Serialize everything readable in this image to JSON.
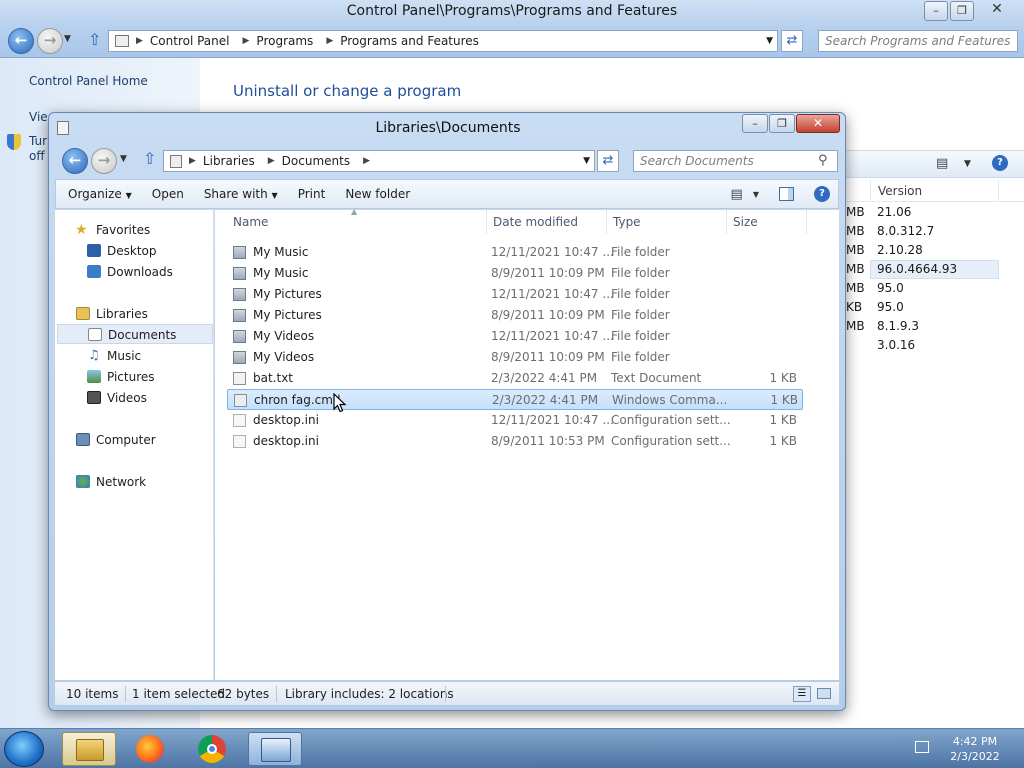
{
  "control_panel": {
    "title": "Control Panel\\Programs\\Programs and Features",
    "breadcrumbs": [
      "Control Panel",
      "Programs",
      "Programs and Features"
    ],
    "search_placeholder": "Search Programs and Features",
    "sidebar": {
      "home": "Control Panel Home",
      "view_partial": "Vie",
      "turn_partial_1": "Tur",
      "turn_partial_2": "off"
    },
    "heading": "Uninstall or change a program",
    "version_header": "Version",
    "size_suffixes": [
      "MB",
      "MB",
      "MB",
      "MB",
      "MB",
      "KB",
      "MB"
    ],
    "versions": [
      "21.06",
      "8.0.312.7",
      "2.10.28",
      "96.0.4664.93",
      "95.0",
      "95.0",
      "8.1.9.3",
      "3.0.16"
    ]
  },
  "explorer": {
    "title": "Libraries\\Documents",
    "breadcrumbs": [
      "Libraries",
      "Documents"
    ],
    "search_placeholder": "Search Documents",
    "toolbar": {
      "organize": "Organize",
      "open": "Open",
      "share_with": "Share with",
      "print": "Print",
      "new_folder": "New folder"
    },
    "nav": {
      "favorites": "Favorites",
      "desktop": "Desktop",
      "downloads": "Downloads",
      "libraries": "Libraries",
      "documents": "Documents",
      "music": "Music",
      "pictures": "Pictures",
      "videos": "Videos",
      "computer": "Computer",
      "network": "Network"
    },
    "columns": [
      "Name",
      "Date modified",
      "Type",
      "Size"
    ],
    "files": [
      {
        "name": "My Music",
        "date": "12/11/2021 10:47 ...",
        "type": "File folder",
        "size": "",
        "icon": "folder-shortcut-icon"
      },
      {
        "name": "My Music",
        "date": "8/9/2011 10:09 PM",
        "type": "File folder",
        "size": "",
        "icon": "folder-shortcut-icon"
      },
      {
        "name": "My Pictures",
        "date": "12/11/2021 10:47 ...",
        "type": "File folder",
        "size": "",
        "icon": "folder-shortcut-icon"
      },
      {
        "name": "My Pictures",
        "date": "8/9/2011 10:09 PM",
        "type": "File folder",
        "size": "",
        "icon": "folder-shortcut-icon"
      },
      {
        "name": "My Videos",
        "date": "12/11/2021 10:47 ...",
        "type": "File folder",
        "size": "",
        "icon": "folder-shortcut-icon"
      },
      {
        "name": "My Videos",
        "date": "8/9/2011 10:09 PM",
        "type": "File folder",
        "size": "",
        "icon": "folder-shortcut-icon"
      },
      {
        "name": "bat.txt",
        "date": "2/3/2022 4:41 PM",
        "type": "Text Document",
        "size": "1 KB",
        "icon": "text-file-icon"
      },
      {
        "name": "chron fag.cmd",
        "date": "2/3/2022 4:41 PM",
        "type": "Windows Comma...",
        "size": "1 KB",
        "icon": "cmd-file-icon",
        "selected": true
      },
      {
        "name": "desktop.ini",
        "date": "12/11/2021 10:47 ...",
        "type": "Configuration sett...",
        "size": "1 KB",
        "icon": "ini-file-icon"
      },
      {
        "name": "desktop.ini",
        "date": "8/9/2011 10:53 PM",
        "type": "Configuration sett...",
        "size": "1 KB",
        "icon": "ini-file-icon"
      }
    ],
    "status": {
      "items": "10 items",
      "selected": "1 item selected",
      "size": "62 bytes",
      "library": "Library includes: 2 locations"
    }
  },
  "taskbar": {
    "apps": [
      "explorer-icon",
      "firefox-icon",
      "chrome-icon",
      "control-panel-icon"
    ],
    "time": "4:42 PM",
    "date": "2/3/2022"
  }
}
